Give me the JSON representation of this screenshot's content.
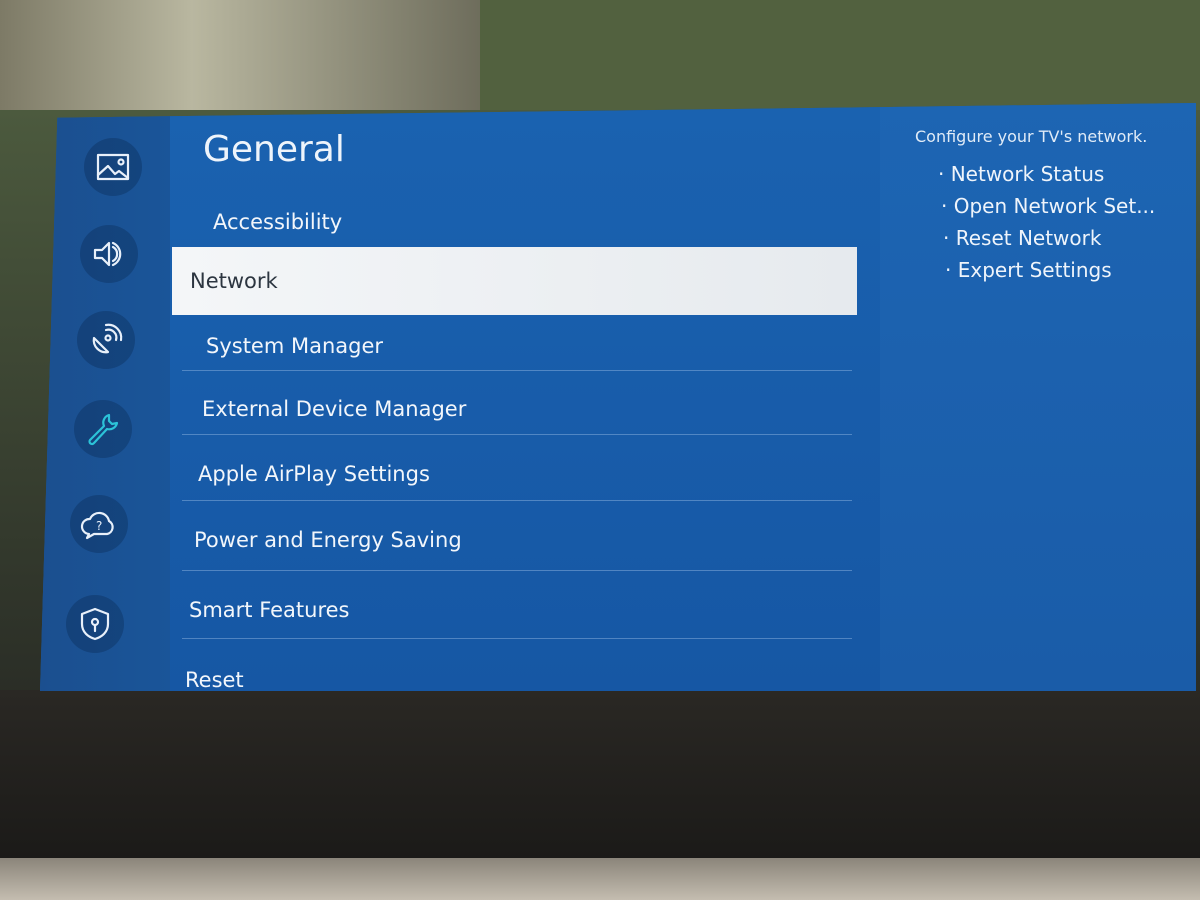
{
  "sidebar": {
    "icons": [
      {
        "name": "picture-icon",
        "active": false
      },
      {
        "name": "sound-icon",
        "active": false
      },
      {
        "name": "broadcasting-icon",
        "active": false
      },
      {
        "name": "general-wrench-icon",
        "active": true
      },
      {
        "name": "support-icon",
        "active": false
      },
      {
        "name": "privacy-shield-icon",
        "active": false
      }
    ],
    "active_color": "#2cc3d8"
  },
  "menu": {
    "title": "General",
    "items": [
      "Accessibility",
      "Network",
      "System Manager",
      "External Device Manager",
      "Apple AirPlay Settings",
      "Power and Energy Saving",
      "Smart Features",
      "Reset"
    ],
    "selected": "Network"
  },
  "details": {
    "description": "Configure your TV's network.",
    "items": [
      "· Network Status",
      "· Open Network Set...",
      "· Reset Network",
      "· Expert Settings"
    ]
  },
  "colors": {
    "menu_bg": "#1a62b0",
    "highlight": "#f4f6f8"
  }
}
